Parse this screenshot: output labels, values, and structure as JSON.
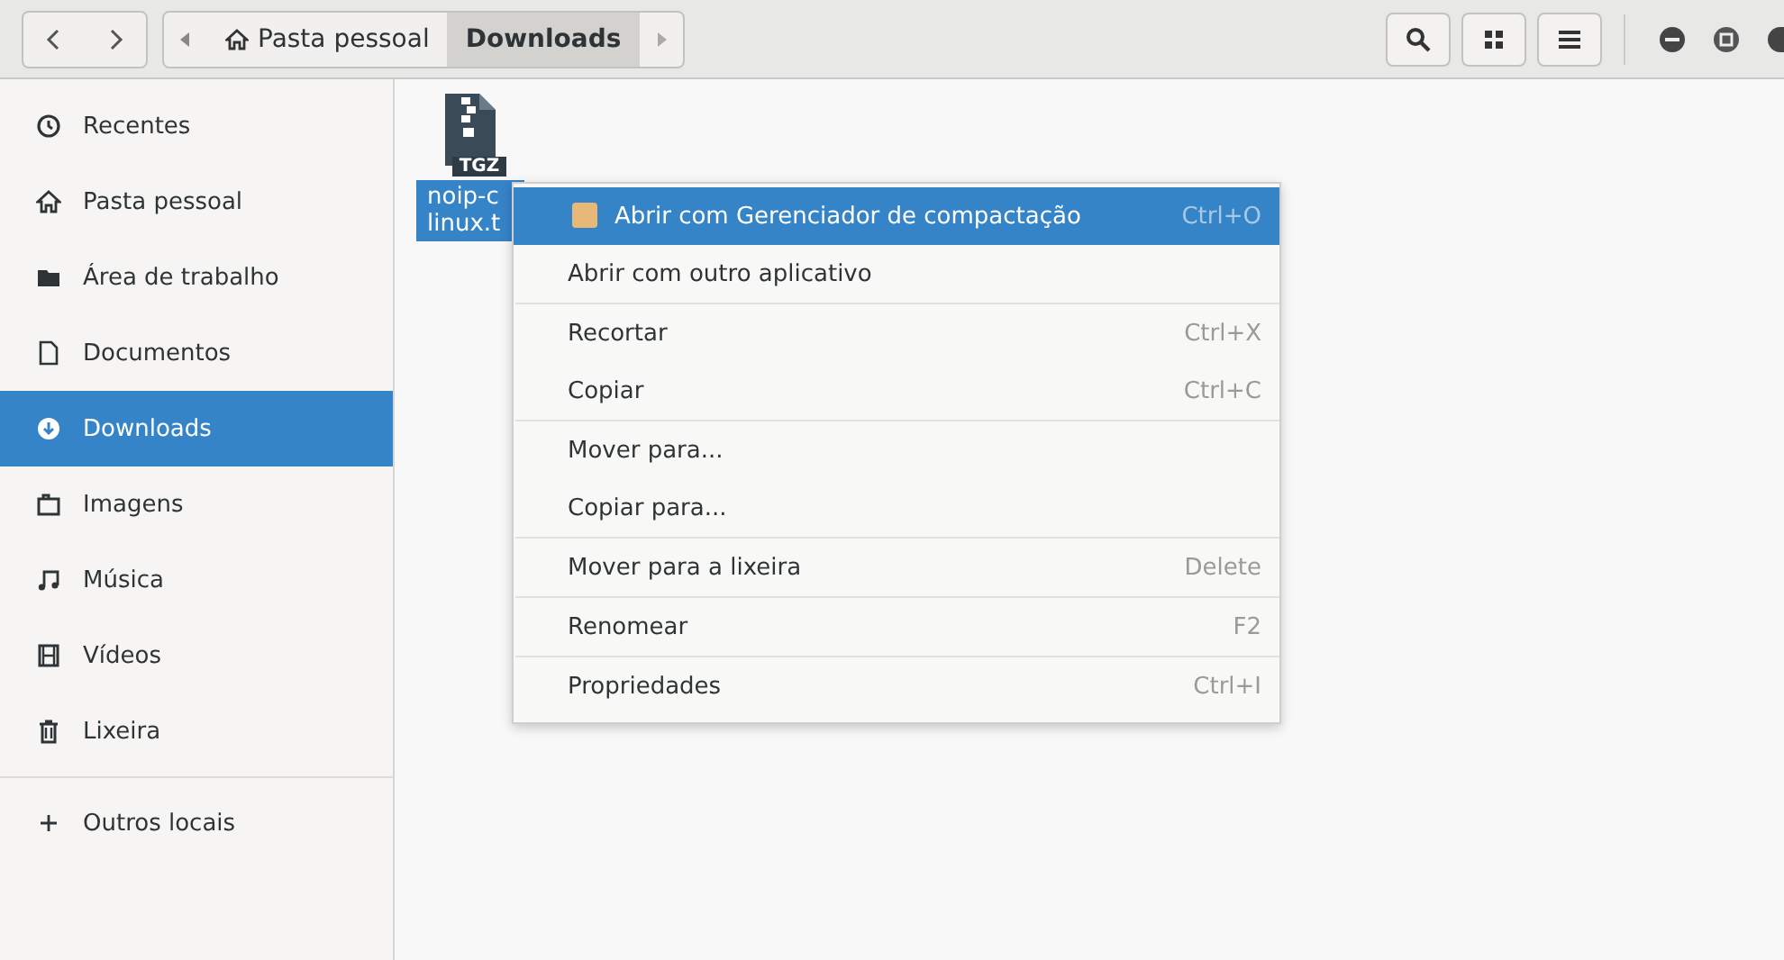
{
  "path_bar": {
    "segments": [
      {
        "label": "Pasta pessoal",
        "kind": "home",
        "selected": false
      },
      {
        "label": "Downloads",
        "kind": "folder",
        "selected": true
      }
    ]
  },
  "sidebar": {
    "items": [
      {
        "label": "Recentes",
        "kind": "recent",
        "selected": false
      },
      {
        "label": "Pasta pessoal",
        "kind": "home",
        "selected": false
      },
      {
        "label": "Área de trabalho",
        "kind": "desktop",
        "selected": false
      },
      {
        "label": "Documentos",
        "kind": "document",
        "selected": false
      },
      {
        "label": "Downloads",
        "kind": "download",
        "selected": true
      },
      {
        "label": "Imagens",
        "kind": "image",
        "selected": false
      },
      {
        "label": "Música",
        "kind": "music",
        "selected": false
      },
      {
        "label": "Vídeos",
        "kind": "video",
        "selected": false
      },
      {
        "label": "Lixeira",
        "kind": "trash",
        "selected": false
      },
      {
        "label": "Outros locais",
        "kind": "other",
        "selected": false
      }
    ]
  },
  "files": [
    {
      "badge": "TGZ",
      "name_lines": [
        "noip-c",
        "linux.t"
      ],
      "selected": true
    }
  ],
  "context_menu": {
    "groups": [
      [
        {
          "label": "Abrir com Gerenciador de compactação",
          "shortcut": "Ctrl+O",
          "icon": true,
          "selected": true
        },
        {
          "label": "Abrir com outro aplicativo",
          "icon": false,
          "selected": false
        }
      ],
      [
        {
          "label": "Recortar",
          "shortcut": "Ctrl+X",
          "icon": false,
          "selected": false
        },
        {
          "label": "Copiar",
          "shortcut": "Ctrl+C",
          "icon": false,
          "selected": false
        }
      ],
      [
        {
          "label": "Mover para...",
          "icon": false,
          "selected": false
        },
        {
          "label": "Copiar para...",
          "icon": false,
          "selected": false
        }
      ],
      [
        {
          "label": "Mover para a lixeira",
          "shortcut": "Delete",
          "icon": false,
          "selected": false
        }
      ],
      [
        {
          "label": "Renomear",
          "shortcut": "F2",
          "icon": false,
          "selected": false
        }
      ],
      [
        {
          "label": "Propriedades",
          "shortcut": "Ctrl+I",
          "icon": false,
          "selected": false
        }
      ]
    ]
  }
}
